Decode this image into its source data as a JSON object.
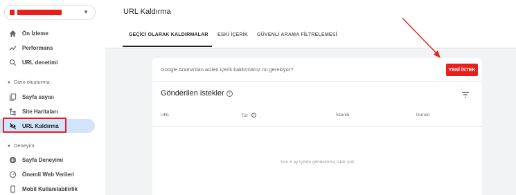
{
  "sidebar": {
    "items": [
      {
        "label": "Ön İzleme",
        "icon": "home-icon"
      },
      {
        "label": "Performans",
        "icon": "trending-icon"
      },
      {
        "label": "URL denetimi",
        "icon": "search-icon"
      }
    ],
    "sections": [
      {
        "label": "Dizin oluşturma",
        "items": [
          {
            "label": "Sayfa sayısı",
            "icon": "pages-icon"
          },
          {
            "label": "Site Haritaları",
            "icon": "sitemap-icon"
          },
          {
            "label": "URL Kaldırma",
            "icon": "eye-off-icon",
            "active": true
          }
        ]
      },
      {
        "label": "Deneyim",
        "items": [
          {
            "label": "Sayfa Deneyimi",
            "icon": "plus-circle-icon"
          },
          {
            "label": "Önemli Web Verileri",
            "icon": "gauge-icon"
          },
          {
            "label": "Mobil Kullanılabilirlik",
            "icon": "phone-icon"
          }
        ]
      }
    ]
  },
  "main": {
    "title": "URL Kaldırma",
    "tabs": [
      {
        "label": "GEÇİCİ OLARAK KALDIRMALAR",
        "active": true
      },
      {
        "label": "ESKİ İÇERİK"
      },
      {
        "label": "GÜVENLİ ARAMA FİLTRELEMESİ"
      }
    ],
    "question": "Google Arama'dan acilen içerik kaldırmanız mı gerekiyor?",
    "new_request_label": "YENİ İSTEK",
    "requests_title": "Gönderilen istekler",
    "columns": [
      "URL",
      "Tür",
      "İstendi",
      "Durum"
    ],
    "empty_message": "Son 6 ay içinde gönderilmiş istek yok"
  },
  "colors": {
    "accent_red": "#e8201c",
    "active_nav_bg": "#d2e3fc",
    "main_bg": "#f1f3f4"
  }
}
